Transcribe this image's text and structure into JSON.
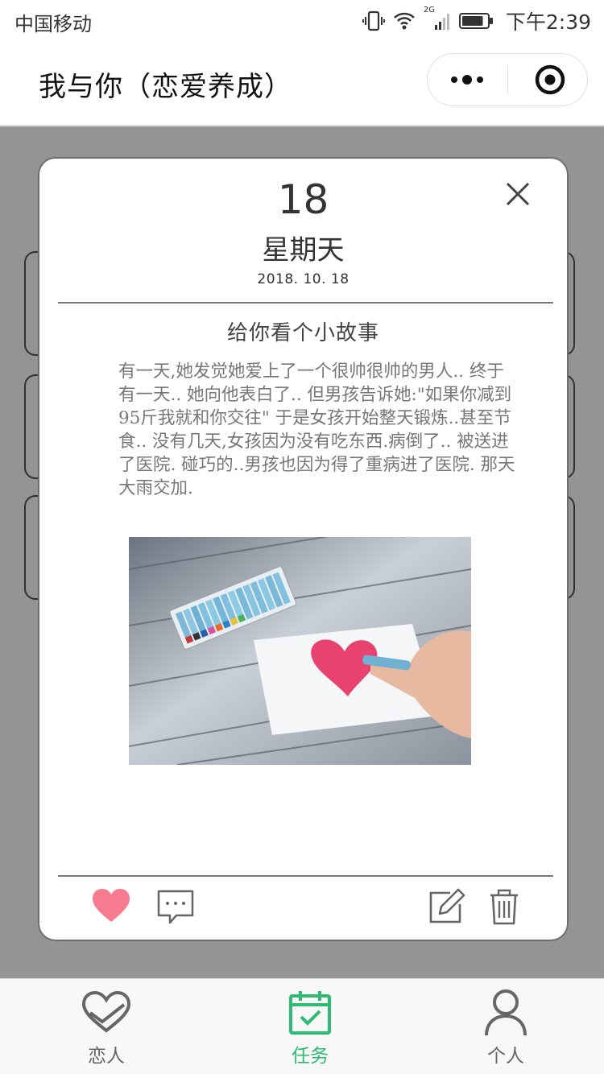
{
  "status_bar": {
    "carrier": "中国移动",
    "network": "2G",
    "time": "下午2:39",
    "battery_level": 0.85
  },
  "header": {
    "title": "我与你（恋爱养成）",
    "icons": [
      "more-icon",
      "close-target-icon"
    ]
  },
  "modal": {
    "day": "18",
    "weekday": "星期天",
    "date": "2018. 10. 18",
    "heading": "给你看个小故事",
    "body": "有一天,她发觉她爱上了一个很帅很帅的男人.. 终于有一天.. 她向他表白了.. 但男孩告诉她:\"如果你减到95斤我就和你交往\" 于是女孩开始整天锻炼..甚至节食.. 没有几天,女孩因为没有吃东西.病倒了.. 被送进了医院. 碰巧的..男孩也因为得了重病进了医院. 那天大雨交加.",
    "actions": [
      "heart-icon",
      "comment-icon",
      "edit-icon",
      "trash-icon"
    ]
  },
  "tabbar": {
    "tabs": [
      {
        "label": "恋人",
        "icon": "heart-outline-icon",
        "active": false
      },
      {
        "label": "任务",
        "icon": "calendar-check-icon",
        "active": true
      },
      {
        "label": "个人",
        "icon": "person-icon",
        "active": false
      }
    ]
  },
  "colors": {
    "accent_green": "#2dba72",
    "heart_pink": "#f77a8f",
    "overlay": "#8a8a8a"
  }
}
